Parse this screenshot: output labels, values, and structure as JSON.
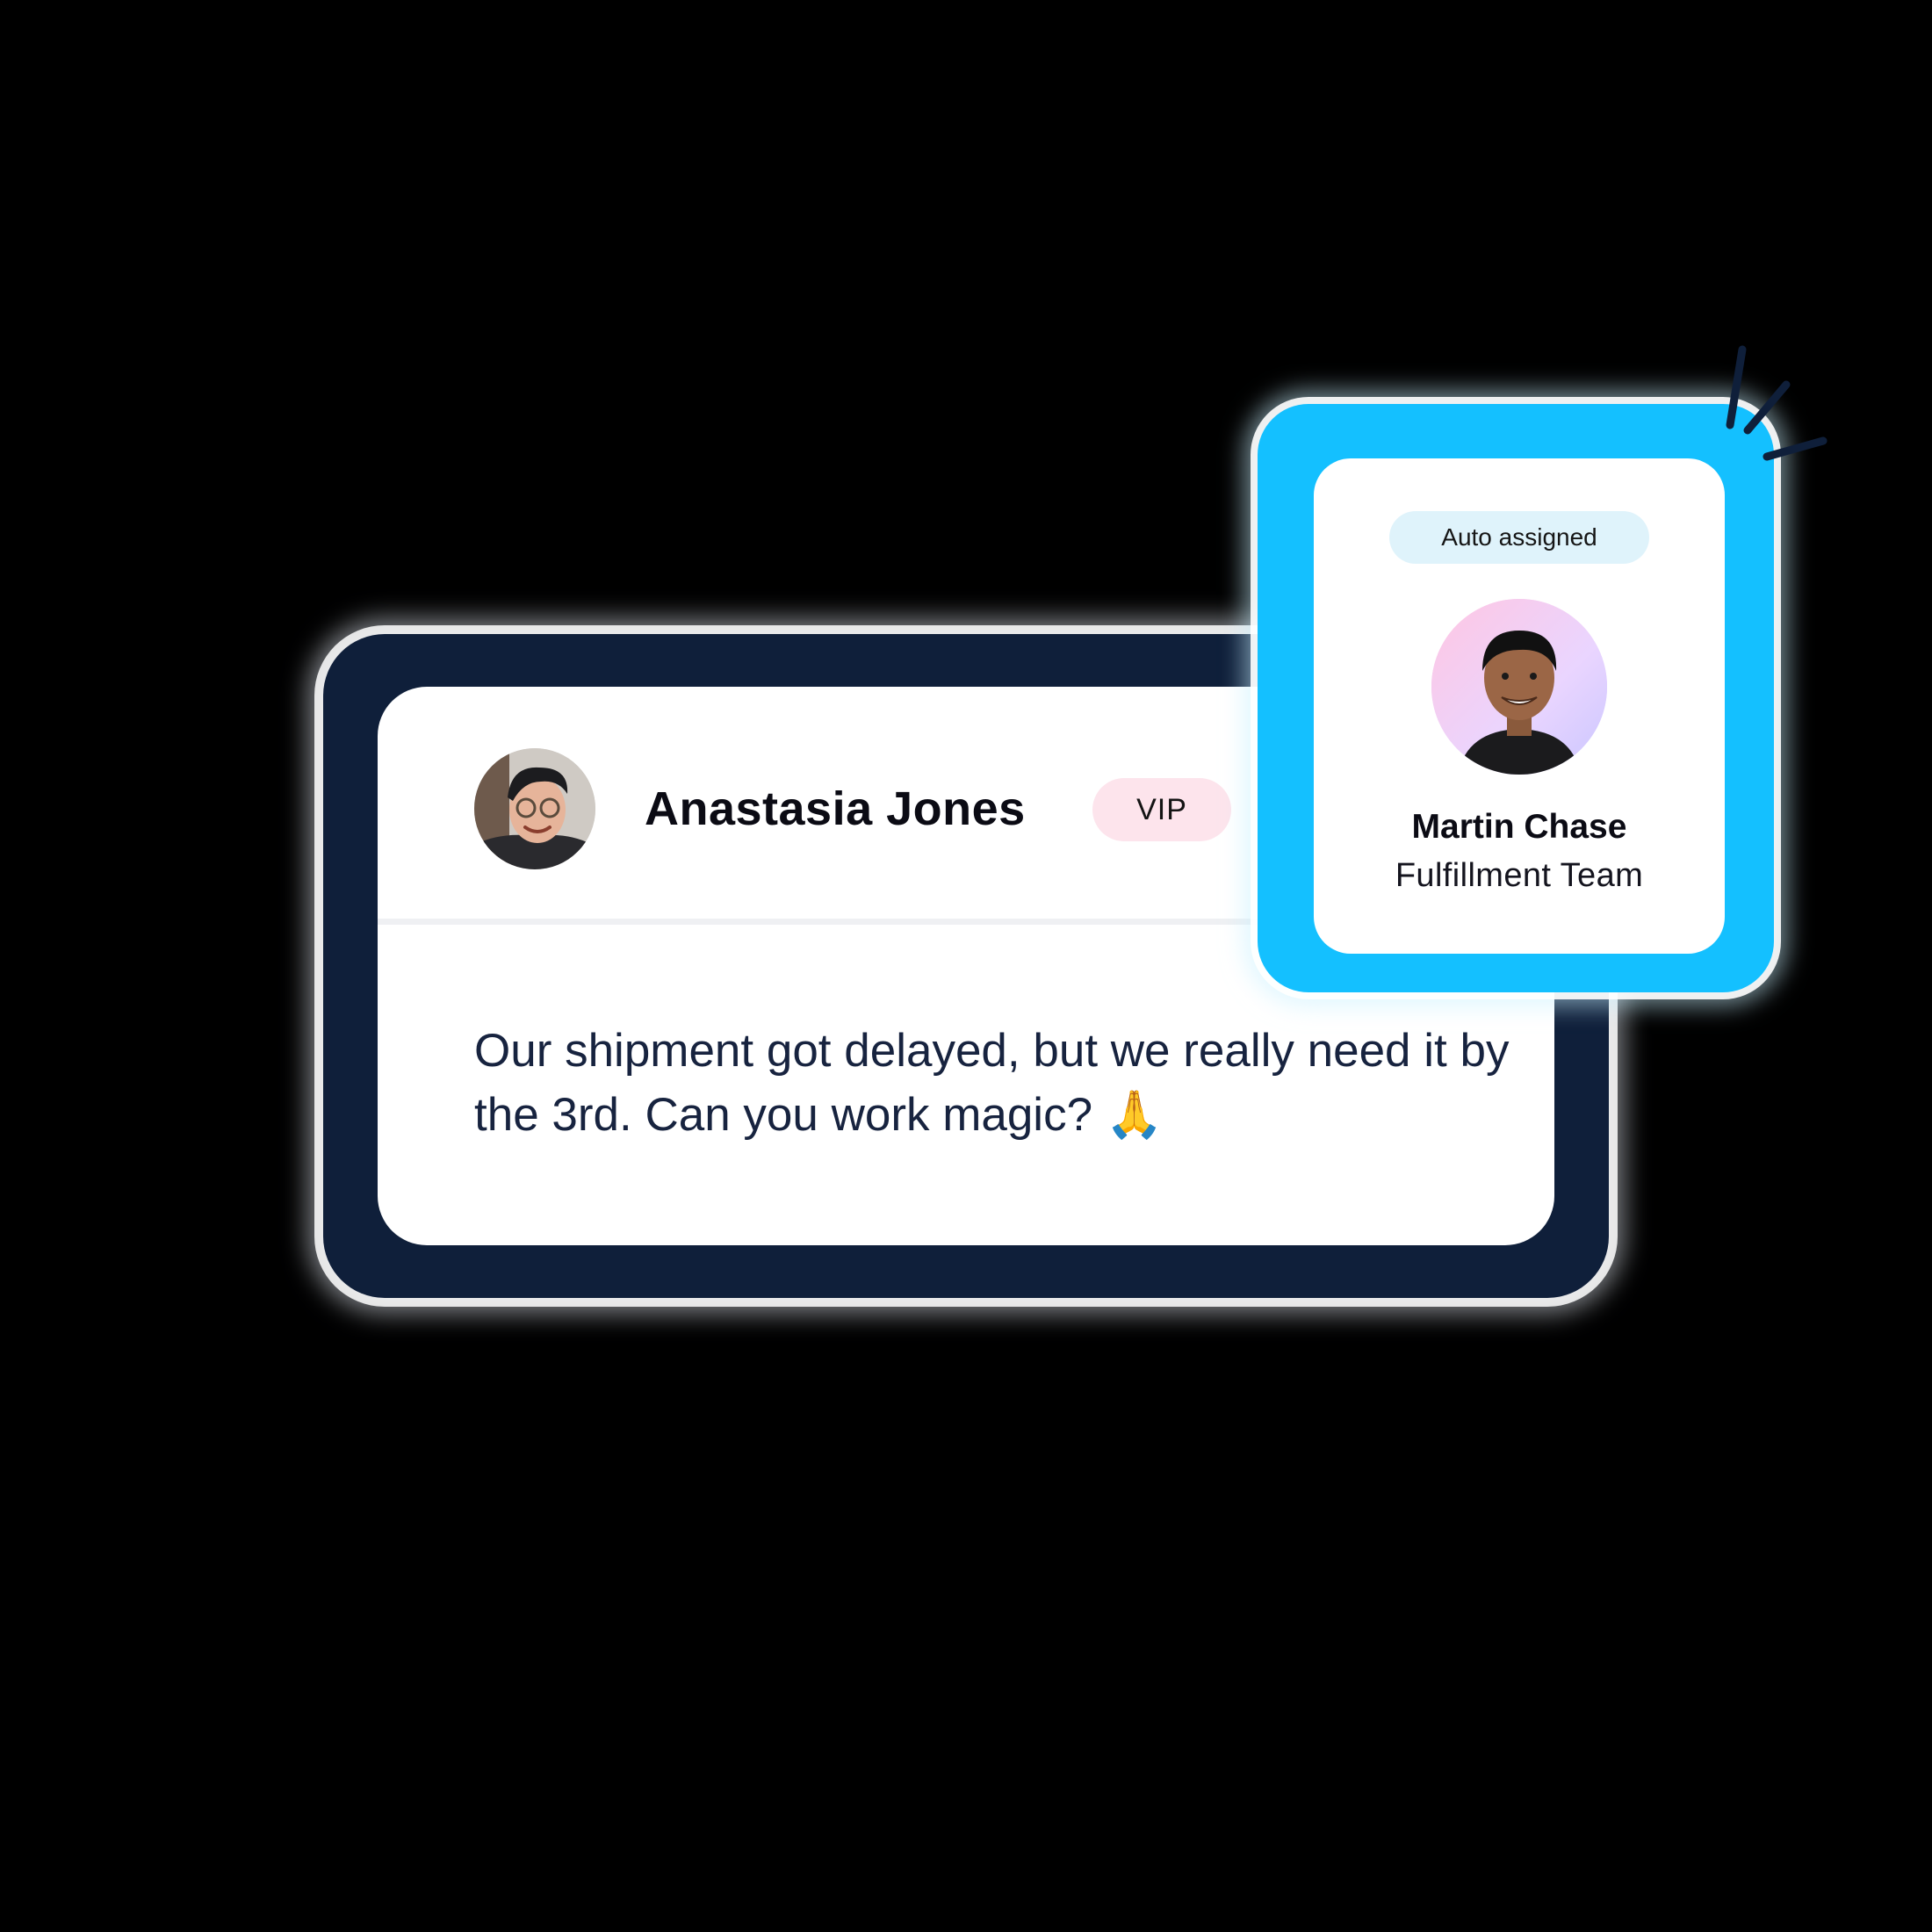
{
  "message_card": {
    "customer": {
      "name": "Anastasia Jones",
      "badge": "VIP"
    },
    "message": {
      "text": "Our shipment got delayed, but we really need it by the 3rd. Can you work magic?",
      "emoji": "🙏"
    }
  },
  "assignment_card": {
    "status_badge": "Auto assigned",
    "agent": {
      "name": "Martin Chase",
      "team": "Fulfillment Team"
    }
  },
  "colors": {
    "glow": "#14c0ff",
    "card_shadow": "#0f1f3a",
    "vip_badge_bg": "#fde4ec",
    "auto_badge_bg": "#dff3fb",
    "message_text": "#17233f"
  },
  "icons": [
    "sparkle-icon",
    "prayer-hands-emoji"
  ]
}
